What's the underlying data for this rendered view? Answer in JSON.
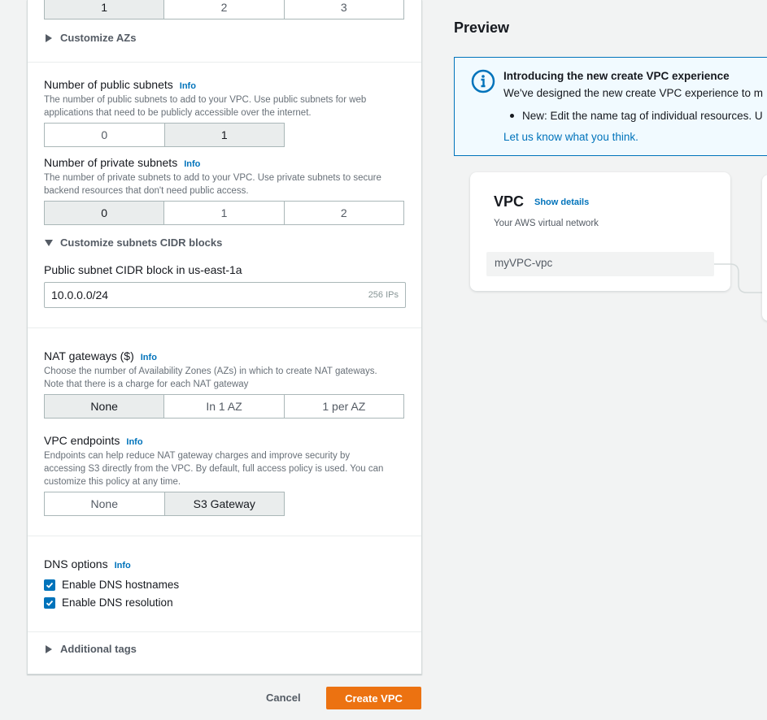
{
  "azs": {
    "options": [
      "1",
      "2",
      "3"
    ],
    "selected": 0,
    "customize_label": "Customize AZs"
  },
  "public_subnets": {
    "label": "Number of public subnets",
    "info": "Info",
    "desc_line1": "The number of public subnets to add to your VPC. Use public subnets for web",
    "desc_line2": "applications that need to be publicly accessible over the internet.",
    "options": [
      "0",
      "1"
    ],
    "selected": 1
  },
  "private_subnets": {
    "label": "Number of private subnets",
    "info": "Info",
    "desc_line1": "The number of private subnets to add to your VPC. Use private subnets to secure",
    "desc_line2": "backend resources that don't need public access.",
    "options": [
      "0",
      "1",
      "2"
    ],
    "selected": 0
  },
  "cidr": {
    "expander_label": "Customize subnets CIDR blocks",
    "field_label": "Public subnet CIDR block in us-east-1a",
    "value": "10.0.0.0/24",
    "suffix": "256 IPs"
  },
  "nat": {
    "label": "NAT gateways ($)",
    "info": "Info",
    "desc_line1": "Choose the number of Availability Zones (AZs) in which to create NAT gateways.",
    "desc_line2": "Note that there is a charge for each NAT gateway",
    "options": [
      "None",
      "In 1 AZ",
      "1 per AZ"
    ],
    "selected": 0
  },
  "endpoints": {
    "label": "VPC endpoints",
    "info": "Info",
    "desc_line1": "Endpoints can help reduce NAT gateway charges and improve security by",
    "desc_line2": "accessing S3 directly from the VPC. By default, full access policy is used. You can",
    "desc_line3": "customize this policy at any time.",
    "options": [
      "None",
      "S3 Gateway"
    ],
    "selected": 1
  },
  "dns": {
    "label": "DNS options",
    "info": "Info",
    "hostnames_label": "Enable DNS hostnames",
    "hostnames_checked": true,
    "resolution_label": "Enable DNS resolution",
    "resolution_checked": true
  },
  "tags": {
    "label": "Additional tags"
  },
  "actions": {
    "cancel": "Cancel",
    "create": "Create VPC"
  },
  "preview": {
    "title": "Preview",
    "banner": {
      "title": "Introducing the new create VPC experience",
      "text": "We've designed the new create VPC experience to m",
      "bullet": "New: Edit the name tag of individual resources. U",
      "link": "Let us know what you think."
    },
    "vpc_card": {
      "title": "VPC",
      "show_details": "Show details",
      "subtitle": "Your AWS virtual network",
      "resource": "myVPC-vpc"
    }
  },
  "colors": {
    "accent": "#0073bb",
    "primary_button": "#ec7211",
    "banner_bg": "#f1faff"
  }
}
